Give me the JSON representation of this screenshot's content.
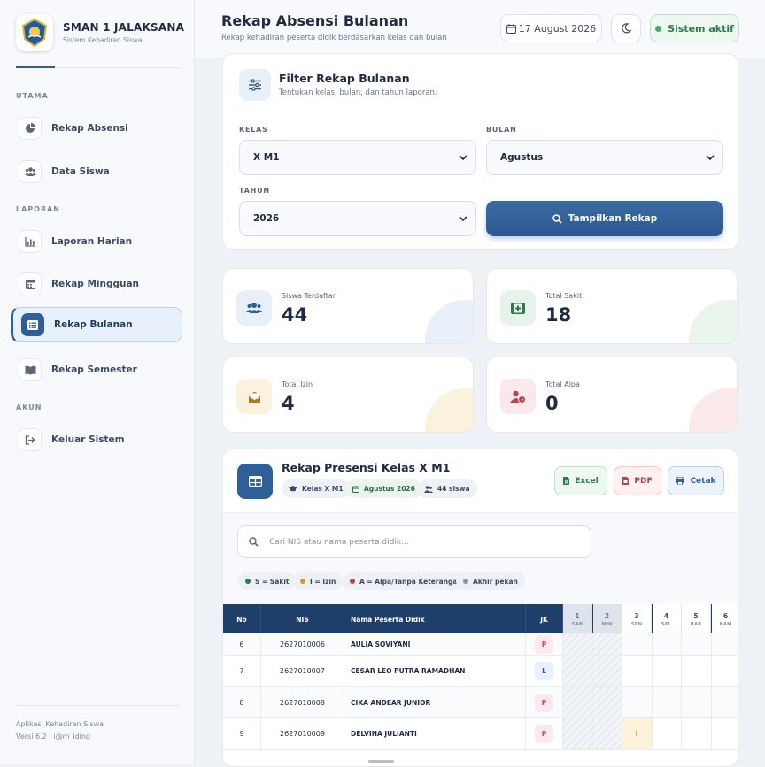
{
  "sidebar": {
    "brand_name": "SMAN 1 JALAKSANA",
    "brand_sub": "Sistem Kehadiran Siswa",
    "sections": {
      "utama": "UTAMA",
      "laporan": "LAPORAN",
      "akun": "AKUN"
    },
    "items": [
      {
        "label": "Rekap Absensi",
        "icon": "pie-chart-icon"
      },
      {
        "label": "Data Siswa",
        "icon": "users-icon"
      },
      {
        "label": "Laporan Harian",
        "icon": "bar-chart-icon"
      },
      {
        "label": "Rekap Mingguan",
        "icon": "calendar-week-icon"
      },
      {
        "label": "Rekap Bulanan",
        "icon": "list-icon",
        "active": true
      },
      {
        "label": "Rekap Semester",
        "icon": "book-icon"
      },
      {
        "label": "Keluar Sistem",
        "icon": "logout-icon"
      }
    ],
    "footer_line1": "Aplikasi Kehadiran Siswa",
    "footer_line2": "Versi 6.2 · i@m_iding"
  },
  "header": {
    "title": "Rekap Absensi Bulanan",
    "subtitle": "Rekap kehadiran peserta didik berdasarkan kelas dan bulan",
    "date": "17 August 2026",
    "status": "Sistem aktif"
  },
  "filter": {
    "title": "Filter Rekap Bulanan",
    "subtitle": "Tentukan kelas, bulan, dan tahun laporan.",
    "kelas_label": "KELAS",
    "kelas_value": "X M1",
    "bulan_label": "BULAN",
    "bulan_value": "Agustus",
    "tahun_label": "TAHUN",
    "tahun_value": "2026",
    "button": "Tampilkan Rekap"
  },
  "stats": [
    {
      "label": "Siswa Terdaftar",
      "value": "44",
      "icon": "users-icon",
      "color": "#2f5f97"
    },
    {
      "label": "Total Sakit",
      "value": "18",
      "icon": "medical-kit-icon",
      "color": "#2e7a4a"
    },
    {
      "label": "Total Izin",
      "value": "4",
      "icon": "envelope-open-icon",
      "color": "#b5791d"
    },
    {
      "label": "Total Alpa",
      "value": "0",
      "icon": "user-clock-icon",
      "color": "#b8434f"
    }
  ],
  "table_section": {
    "title": "Rekap Presensi Kelas X M1",
    "chips": {
      "kelas": "Kelas X M1",
      "bulan": "Agustus 2026",
      "siswa": "44 siswa"
    },
    "buttons": {
      "excel": "Excel",
      "pdf": "PDF",
      "cetak": "Cetak"
    },
    "search_placeholder": "Cari NIS atau nama peserta didik...",
    "legend": {
      "s": "S = Sakit",
      "i": "I = Izin",
      "a": "A = Alpa/Tanpa Keterangan",
      "weekend": "Akhir pekan"
    },
    "headers": {
      "no": "No",
      "nis": "NIS",
      "name": "Nama Peserta Didik",
      "jk": "JK"
    },
    "days": [
      {
        "num": "1",
        "name": "SAB",
        "weekend": true
      },
      {
        "num": "2",
        "name": "MIN",
        "weekend": true
      },
      {
        "num": "3",
        "name": "SEN",
        "weekend": false
      },
      {
        "num": "4",
        "name": "SEL",
        "weekend": false
      },
      {
        "num": "5",
        "name": "RAB",
        "weekend": false
      },
      {
        "num": "6",
        "name": "KAM",
        "weekend": false
      }
    ],
    "rows": [
      {
        "no": "6",
        "nis": "2627010006",
        "name": "AULIA SOVIYANI",
        "jk": "P",
        "marks": [
          "",
          "",
          "",
          "",
          "",
          ""
        ]
      },
      {
        "no": "7",
        "nis": "2627010007",
        "name": "CESAR LEO PUTRA RAMADHAN",
        "jk": "L",
        "marks": [
          "",
          "",
          "",
          "",
          "",
          ""
        ]
      },
      {
        "no": "8",
        "nis": "2627010008",
        "name": "CIKA ANDEAR JUNIOR",
        "jk": "P",
        "marks": [
          "",
          "",
          "",
          "",
          "",
          ""
        ]
      },
      {
        "no": "9",
        "nis": "2627010009",
        "name": "DELVINA JULIANTI",
        "jk": "P",
        "marks": [
          "",
          "",
          "I",
          "",
          "",
          ""
        ]
      }
    ]
  },
  "colors": {
    "primary": "#2f5f97",
    "navy": "#1f3f6b",
    "success": "#3fae6a",
    "izin": "#b5791d",
    "alpa": "#b8434f"
  }
}
